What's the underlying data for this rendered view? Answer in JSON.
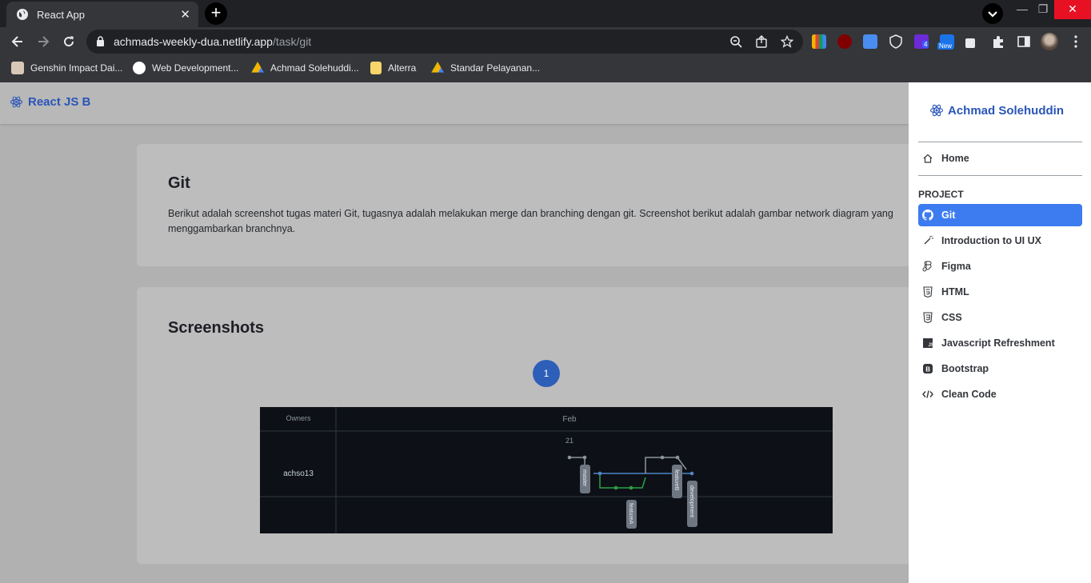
{
  "browser": {
    "tab_title": "React App",
    "tab_close": "✕",
    "new_tab": "+",
    "window": {
      "minimize": "—",
      "restore": "❐",
      "close": "✕"
    },
    "url_host": "achmads-weekly-dua.netlify.app",
    "url_path": "/task/git",
    "extension_badges": {
      "count": "4",
      "new": "New"
    },
    "bookmarks": [
      {
        "label": "Genshin Impact Dai...",
        "icon": "genshin-icon"
      },
      {
        "label": "Web Development...",
        "icon": "webdev-icon"
      },
      {
        "label": "Achmad Solehuddi...",
        "icon": "google-drive-icon"
      },
      {
        "label": "Alterra",
        "icon": "folder-icon"
      },
      {
        "label": "Standar Pelayanan...",
        "icon": "google-drive-icon"
      }
    ]
  },
  "navbar": {
    "brand": "React JS B"
  },
  "git_card": {
    "title": "Git",
    "text": "Berikut adalah screenshot tugas materi Git, tugasnya adalah melakukan merge dan branching dengan git. Screenshot berikut adalah gambar network diagram yang menggambarkan branchnya."
  },
  "screenshots_card": {
    "title": "Screenshots",
    "page": "1",
    "diagram": {
      "owners_header": "Owners",
      "month_header": "Feb",
      "day": "21",
      "owner": "achso13",
      "branches": [
        "master",
        "featureA",
        "featureB",
        "development"
      ]
    }
  },
  "sidebar": {
    "brand": "Achmad Solehuddin",
    "home": "Home",
    "section": "PROJECT",
    "items": [
      {
        "label": "Git",
        "icon": "github-icon",
        "active": true
      },
      {
        "label": "Introduction to UI UX",
        "icon": "magic-wand-icon",
        "active": false
      },
      {
        "label": "Figma",
        "icon": "figma-icon",
        "active": false
      },
      {
        "label": "HTML",
        "icon": "html5-icon",
        "active": false
      },
      {
        "label": "CSS",
        "icon": "css3-icon",
        "active": false
      },
      {
        "label": "Javascript Refreshment",
        "icon": "javascript-icon",
        "active": false
      },
      {
        "label": "Bootstrap",
        "icon": "bootstrap-icon",
        "active": false
      },
      {
        "label": "Clean Code",
        "icon": "code-icon",
        "active": false
      }
    ]
  },
  "colors": {
    "accent": "#3d7cf0",
    "brand": "#2a55b8",
    "diagram_bg": "#0d1117"
  }
}
